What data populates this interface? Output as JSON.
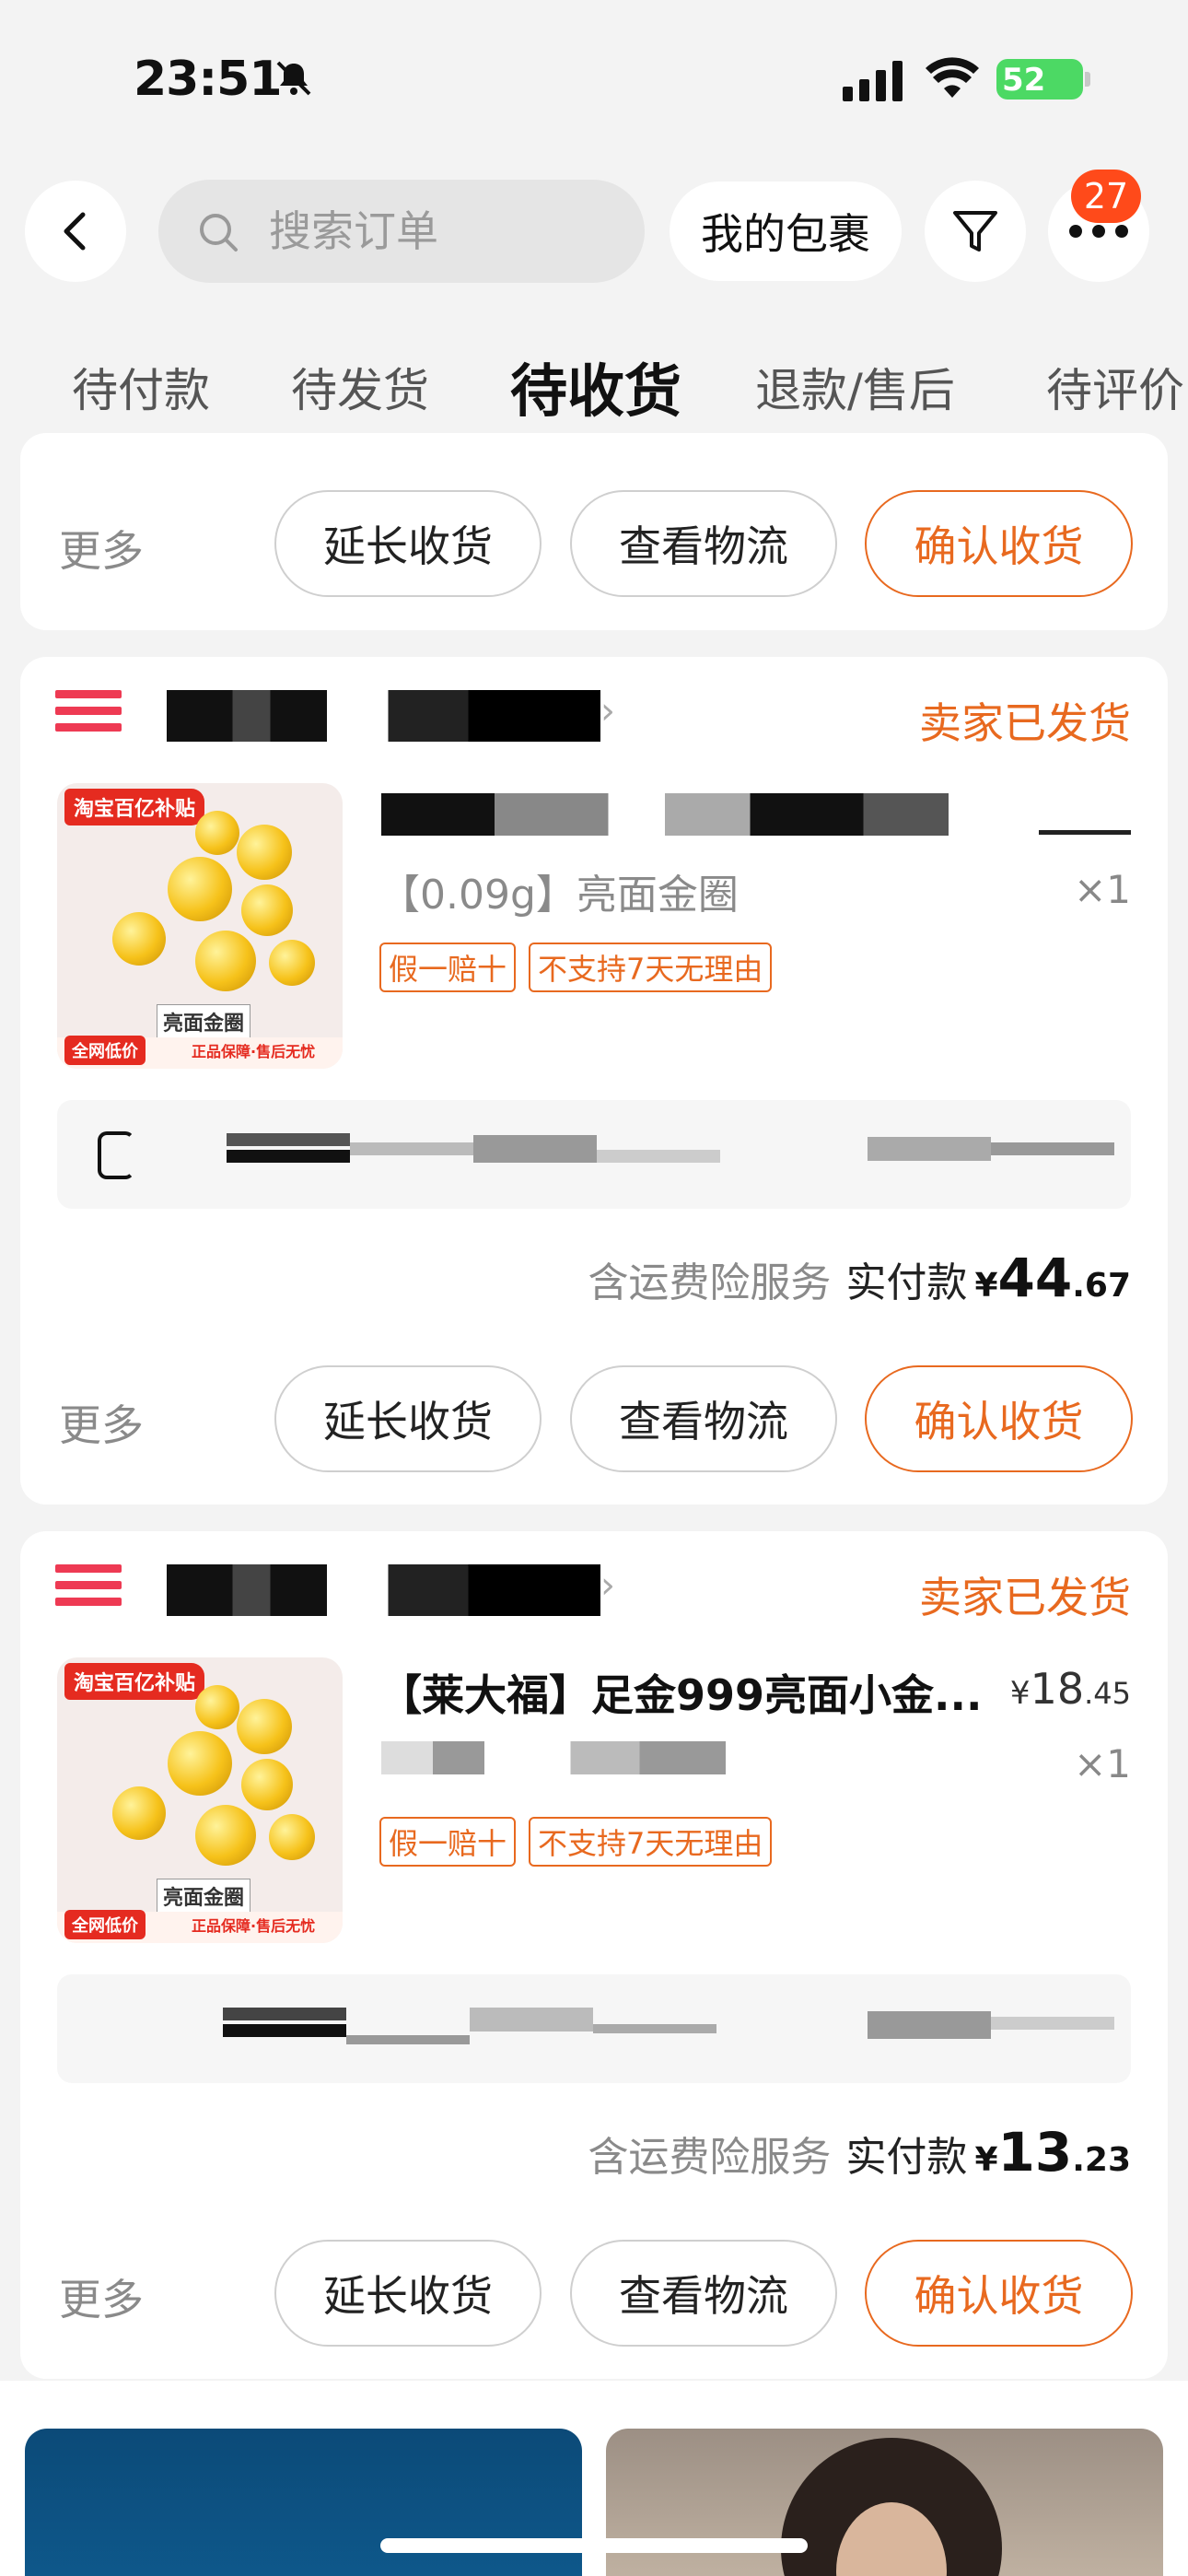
{
  "status_bar": {
    "time": "23:51",
    "battery": "52"
  },
  "header": {
    "search_placeholder": "搜索订单",
    "packages_label": "我的包裹",
    "badge_count": "27"
  },
  "tabs": [
    {
      "label": "待付款"
    },
    {
      "label": "待发货"
    },
    {
      "label": "待收货",
      "active": true
    },
    {
      "label": "退款/售后"
    },
    {
      "label": "待评价"
    }
  ],
  "actions": {
    "more": "更多",
    "extend": "延长收货",
    "logistics": "查看物流",
    "confirm": "确认收货"
  },
  "orders": [
    {
      "status": "卖家已发货",
      "variant": "【0.09g】亮面金圈",
      "qty": "×1",
      "tags": [
        "假一赔十",
        "不支持7天无理由"
      ],
      "service": "含运费险服务",
      "paid_label": "实付款",
      "currency": "¥",
      "paid_int": "44",
      "paid_dec": ".67"
    },
    {
      "status": "卖家已发货",
      "title": "【莱大福】足金999亮面小金...",
      "unit_currency": "¥",
      "unit_int": "18",
      "unit_dec": ".45",
      "qty": "×1",
      "tags": [
        "假一赔十",
        "不支持7天无理由"
      ],
      "service": "含运费险服务",
      "paid_label": "实付款",
      "currency": "¥",
      "paid_int": "13",
      "paid_dec": ".23"
    }
  ],
  "product_image": {
    "subsidy_tag": "淘宝百亿补贴",
    "jewelry_name": "亮面金圈",
    "low_price": "全网低价",
    "guarantee": "正品保障·售后无忧"
  },
  "colors": {
    "accent": "#e8691f",
    "badge": "#ff4a1a"
  }
}
